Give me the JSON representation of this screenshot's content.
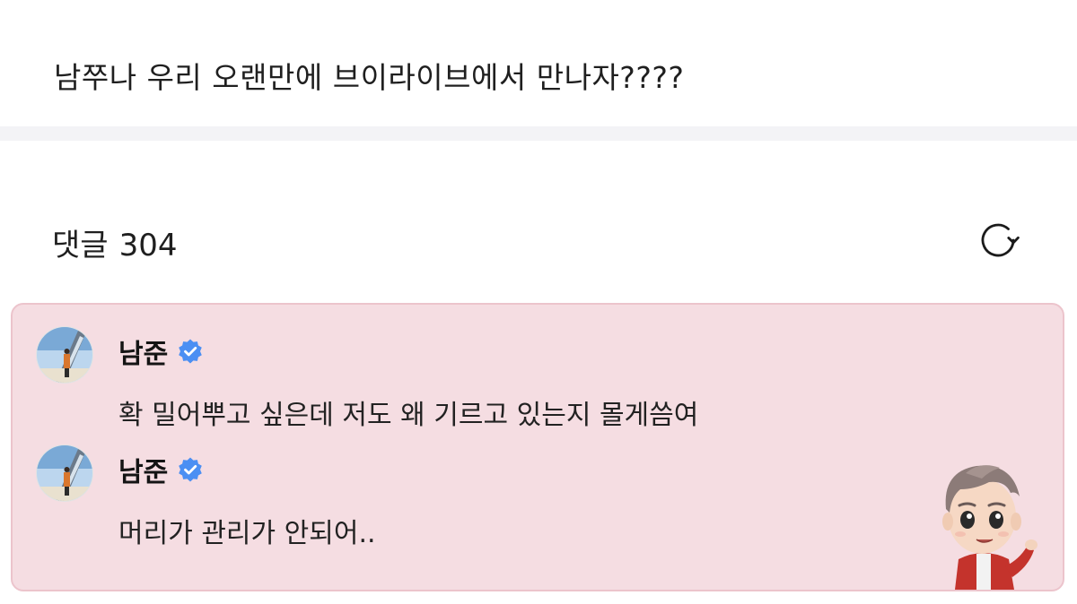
{
  "post": {
    "text": "남쭈나 우리 오랜만에 브이라이브에서 만나자????"
  },
  "comments_header": {
    "label": "댓글",
    "count": "304",
    "refresh_icon": "refresh-icon"
  },
  "pinned_comments": [
    {
      "author": "남준",
      "verified_icon": "verified-badge-icon",
      "text": "확 밀어뿌고 싶은데 저도 왜 기르고 있는지 몰게씀여"
    },
    {
      "author": "남준",
      "verified_icon": "verified-badge-icon",
      "text": "머리가 관리가 안되어.."
    }
  ],
  "colors": {
    "pinned_bg": "#f5dde2",
    "pinned_border": "#ecc4cc",
    "verified": "#4b8ff3",
    "divider": "#f3f3f6"
  }
}
